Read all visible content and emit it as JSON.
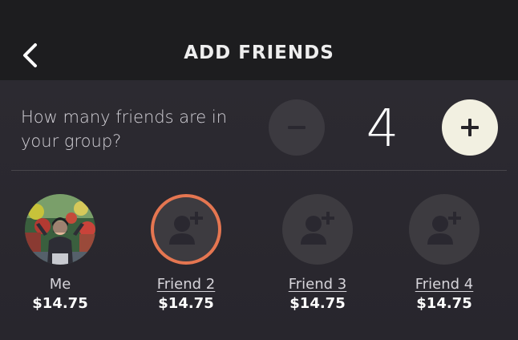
{
  "header": {
    "title": "ADD FRIENDS",
    "back_icon": "chevron-left-icon"
  },
  "question": {
    "text": "How many friends are in your group?"
  },
  "stepper": {
    "count": "4",
    "minus_icon": "minus-icon",
    "plus_icon": "plus-icon"
  },
  "friends": [
    {
      "name": "Me",
      "price": "$14.75",
      "avatar": "photo"
    },
    {
      "name": "Friend 2",
      "price": "$14.75",
      "avatar": "add-person-icon",
      "selected": true
    },
    {
      "name": "Friend 3",
      "price": "$14.75",
      "avatar": "add-person-icon"
    },
    {
      "name": "Friend 4",
      "price": "$14.75",
      "avatar": "add-person-icon"
    }
  ],
  "colors": {
    "header_bg": "#1d1d1f",
    "body_bg": "#2a2830",
    "accent_orange": "#e57651",
    "plus_button": "#f2f0e1",
    "minus_button": "#3c3a40"
  }
}
